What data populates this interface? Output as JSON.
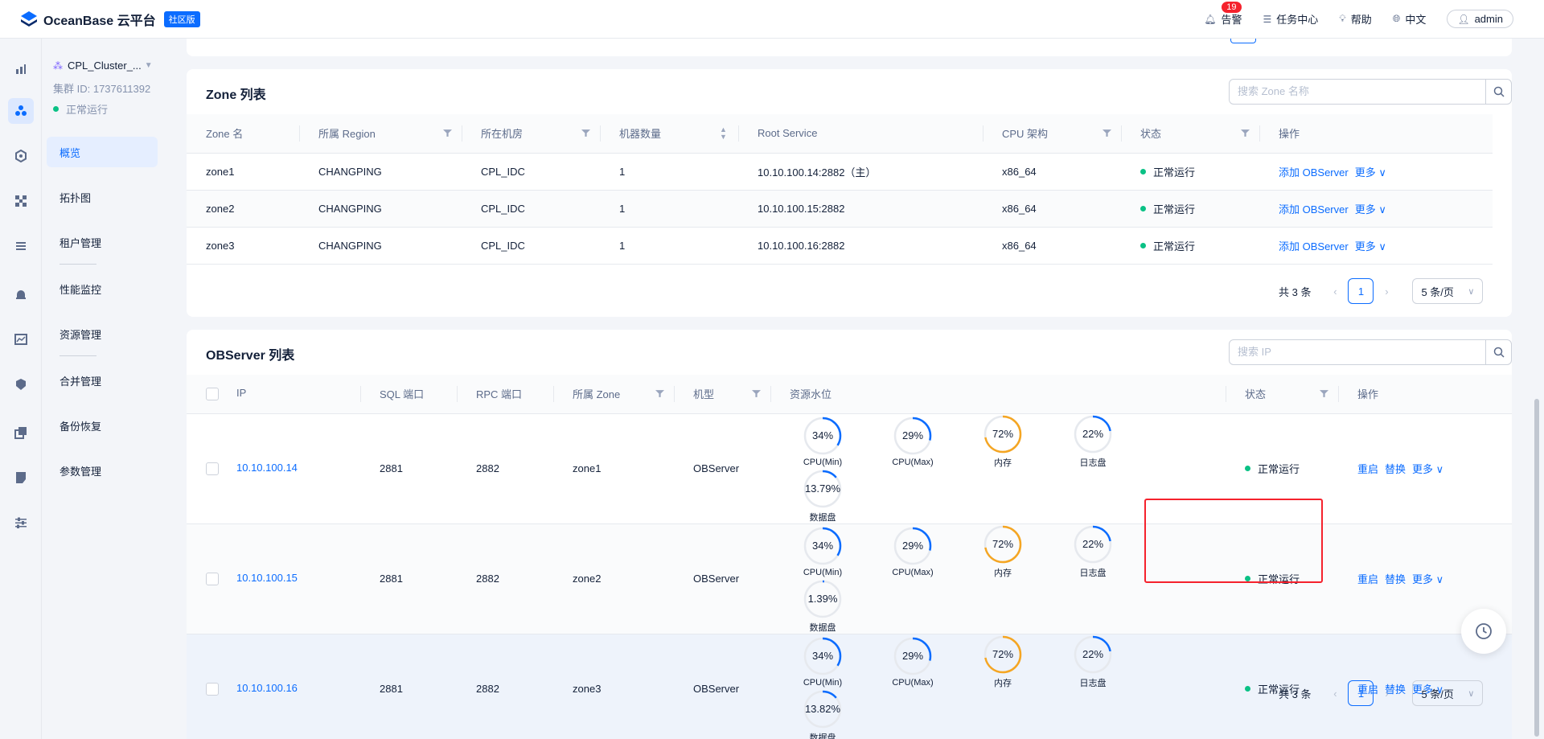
{
  "header": {
    "brand": "OceanBase 云平台",
    "edition_badge": "社区版",
    "alarm_label": "告警",
    "alarm_count": "19",
    "tasks_label": "任务中心",
    "help_label": "帮助",
    "language_label": "中文",
    "user_label": "admin"
  },
  "cluster": {
    "name": "CPL_Cluster_...",
    "id_text": "集群 ID: 1737611392",
    "status": "正常运行"
  },
  "nav": {
    "items": [
      "概览",
      "拓扑图",
      "租户管理",
      "性能监控",
      "资源管理",
      "合并管理",
      "备份恢复",
      "参数管理"
    ],
    "active": "概览"
  },
  "zone_table": {
    "title": "Zone 列表",
    "search_placeholder": "搜索 Zone 名称",
    "columns": [
      "Zone 名",
      "所属 Region",
      "所在机房",
      "机器数量",
      "Root Service",
      "CPU 架构",
      "状态",
      "操作"
    ],
    "rows": [
      {
        "zone": "zone1",
        "region": "CHANGPING",
        "idc": "CPL_IDC",
        "count": "1",
        "root_service": "10.10.100.14:2882（主）",
        "arch": "x86_64",
        "status": "正常运行",
        "op_add": "添加 OBServer",
        "op_more": "更多"
      },
      {
        "zone": "zone2",
        "region": "CHANGPING",
        "idc": "CPL_IDC",
        "count": "1",
        "root_service": "10.10.100.15:2882",
        "arch": "x86_64",
        "status": "正常运行",
        "op_add": "添加 OBServer",
        "op_more": "更多"
      },
      {
        "zone": "zone3",
        "region": "CHANGPING",
        "idc": "CPL_IDC",
        "count": "1",
        "root_service": "10.10.100.16:2882",
        "arch": "x86_64",
        "status": "正常运行",
        "op_add": "添加 OBServer",
        "op_more": "更多"
      }
    ],
    "total_text": "共 3 条",
    "page": "1",
    "page_size": "5 条/页"
  },
  "server_table": {
    "title": "OBServer 列表",
    "search_placeholder": "搜索 IP",
    "columns": [
      "IP",
      "SQL 端口",
      "RPC 端口",
      "所属 Zone",
      "机型",
      "资源水位",
      "状态",
      "操作"
    ],
    "gauge_labels": [
      "CPU(Min)",
      "CPU(Max)",
      "内存",
      "日志盘",
      "数据盘"
    ],
    "rows": [
      {
        "ip": "10.10.100.14",
        "sql_port": "2881",
        "rpc_port": "2882",
        "zone": "zone1",
        "type": "OBServer",
        "gauges": [
          "34%",
          "29%",
          "72%",
          "22%",
          "13.79%"
        ],
        "gauge_fractions": [
          0.34,
          0.29,
          0.72,
          0.22,
          0.1379
        ],
        "status": "正常运行",
        "op_restart": "重启",
        "op_replace": "替换",
        "op_more": "更多"
      },
      {
        "ip": "10.10.100.15",
        "sql_port": "2881",
        "rpc_port": "2882",
        "zone": "zone2",
        "type": "OBServer",
        "gauges": [
          "34%",
          "29%",
          "72%",
          "22%",
          "1.39%"
        ],
        "gauge_fractions": [
          0.34,
          0.29,
          0.72,
          0.22,
          0.0139
        ],
        "status": "正常运行",
        "op_restart": "重启",
        "op_replace": "替换",
        "op_more": "更多"
      },
      {
        "ip": "10.10.100.16",
        "sql_port": "2881",
        "rpc_port": "2882",
        "zone": "zone3",
        "type": "OBServer",
        "gauges": [
          "34%",
          "29%",
          "72%",
          "22%",
          "13.82%"
        ],
        "gauge_fractions": [
          0.34,
          0.29,
          0.72,
          0.22,
          0.1382
        ],
        "status": "正常运行",
        "op_restart": "重启",
        "op_replace": "替换",
        "op_more": "更多"
      }
    ],
    "total_text": "共 3 条",
    "page": "1",
    "page_size": "5 条/页"
  },
  "colors": {
    "primary": "#0b6cff",
    "success": "#0ac185",
    "memory_gauge": "#f5a623",
    "highlight": "#f5222d",
    "gauge_track": "#e6e9ee"
  }
}
